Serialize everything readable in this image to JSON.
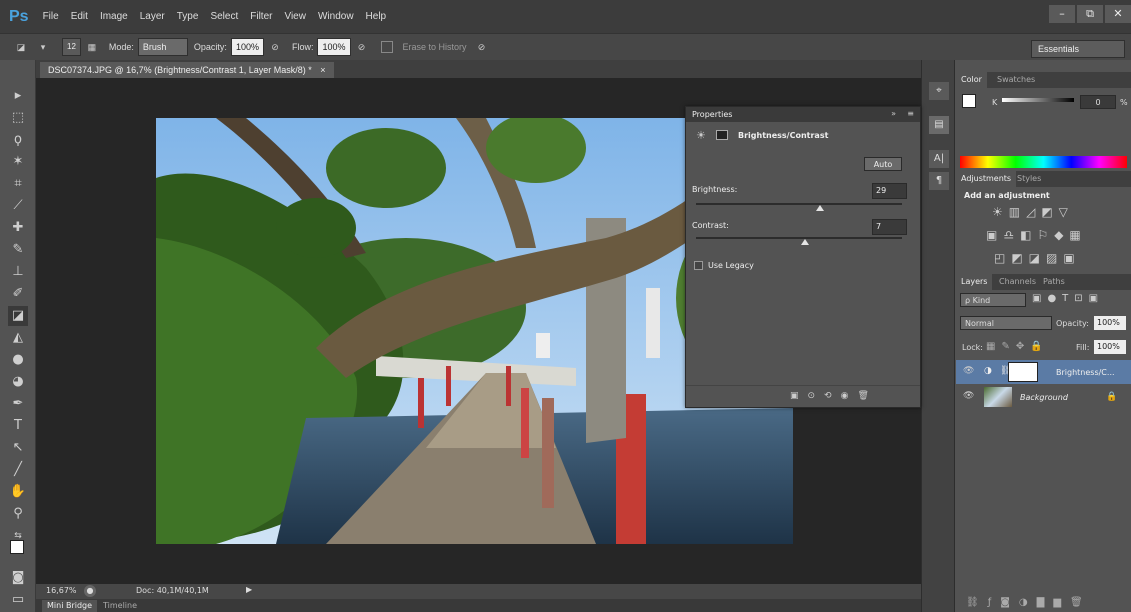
{
  "app": {
    "logo": "Ps"
  },
  "menu": [
    "File",
    "Edit",
    "Image",
    "Layer",
    "Type",
    "Select",
    "Filter",
    "View",
    "Window",
    "Help"
  ],
  "window_controls": {
    "minimize": "–",
    "restore": "⧉",
    "close": "✕"
  },
  "options": {
    "brush_size": "12",
    "mode_label": "Mode:",
    "mode_value": "Brush",
    "opacity_label": "Opacity:",
    "opacity_value": "100%",
    "flow_label": "Flow:",
    "flow_value": "100%",
    "erase_history": "Erase to History",
    "workspace": "Essentials"
  },
  "document": {
    "tab_title": "DSC07374.JPG @ 16,7% (Brightness/Contrast 1, Layer Mask/8) *",
    "close": "×"
  },
  "status": {
    "zoom": "16,67%",
    "doc": "Doc: 40,1M/40,1M"
  },
  "bottom_tabs": [
    "Mini Bridge",
    "Timeline"
  ],
  "color_panel": {
    "tabs": [
      "Color",
      "Swatches"
    ],
    "k_label": "K",
    "k_value": "0",
    "unit": "%"
  },
  "adjustments_panel": {
    "tabs": [
      "Adjustments",
      "Styles"
    ],
    "heading": "Add an adjustment"
  },
  "layers_panel": {
    "tabs": [
      "Layers",
      "Channels",
      "Paths"
    ],
    "kind": "ρ Kind",
    "blend": "Normal",
    "opacity_label": "Opacity:",
    "opacity_value": "100%",
    "lock_label": "Lock:",
    "fill_label": "Fill:",
    "fill_value": "100%",
    "layers": [
      {
        "name": "Brightness/C...",
        "selected": true
      },
      {
        "name": "Background",
        "selected": false
      }
    ]
  },
  "properties": {
    "title": "Properties",
    "heading": "Brightness/Contrast",
    "auto": "Auto",
    "brightness_label": "Brightness:",
    "brightness_value": "29",
    "brightness_level": 0.6,
    "contrast_label": "Contrast:",
    "contrast_value": "7",
    "contrast_level": 0.53,
    "legacy_label": "Use Legacy"
  },
  "colors": {
    "ps_blue": "#4aa3df",
    "selection": "#5b7ba5"
  }
}
